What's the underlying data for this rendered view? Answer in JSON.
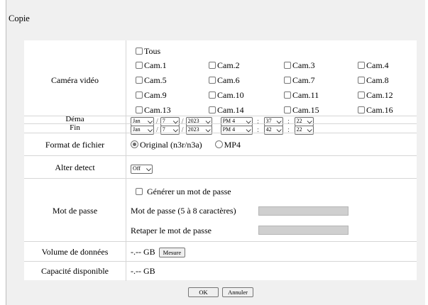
{
  "title": "Copie",
  "camera": {
    "label": "Caméra vidéo",
    "all_label": "Tous",
    "cams": [
      "Cam.1",
      "Cam.2",
      "Cam.3",
      "Cam.4",
      "Cam.5",
      "Cam.6",
      "Cam.7",
      "Cam.8",
      "Cam.9",
      "Cam.10",
      "Cam.11",
      "Cam.12",
      "Cam.13",
      "Cam.14",
      "Cam.15",
      "Cam.16"
    ]
  },
  "start": {
    "label": "Déma",
    "month": "Jan",
    "day": "7",
    "year": "2023",
    "hour": "PM 4",
    "minute": "37",
    "second": "22"
  },
  "end": {
    "label": "Fin",
    "month": "Jan",
    "day": "7",
    "year": "2023",
    "hour": "PM 4",
    "minute": "42",
    "second": "22"
  },
  "date_separator": "/",
  "time_separator": ":",
  "format": {
    "label": "Format de fichier",
    "option_original": "Original (n3r/n3a)",
    "option_mp4": "MP4",
    "selected": "original"
  },
  "alter": {
    "label": "Alter detect",
    "value": "Off"
  },
  "password": {
    "label": "Mot de passe",
    "generate_label": "Générer un mot de passe",
    "field_label": "Mot de passe (5 à 8 caractères)",
    "retype_label": "Retaper le mot de passe"
  },
  "volume": {
    "label": "Volume de données",
    "value": "-.-- GB",
    "measure_button": "Mesure"
  },
  "capacity": {
    "label": "Capacité disponible",
    "value": "-.-- GB"
  },
  "buttons": {
    "ok": "OK",
    "cancel": "Annuler"
  }
}
